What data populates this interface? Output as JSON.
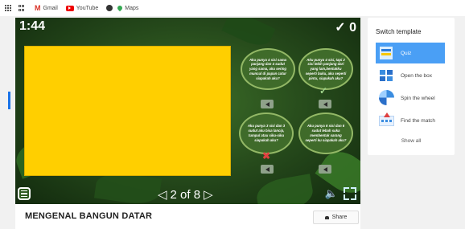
{
  "bookmarks": {
    "items": [
      {
        "label": "Gmail",
        "icon": "gmail-icon"
      },
      {
        "label": "YouTube",
        "icon": "youtube-icon"
      },
      {
        "label": "",
        "icon": "globe-icon"
      },
      {
        "label": "Maps",
        "icon": "maps-icon"
      }
    ]
  },
  "game": {
    "timer": "1:44",
    "score": "✓ 0",
    "pager": {
      "current": "2",
      "sep": "of",
      "total": "8",
      "text": "2 of 8"
    },
    "questions": [
      {
        "text": "Aku punya 4 sisi sama panjang dan 4 sudut yang sama, aku sering muncul di papan catur siapakah aku?"
      },
      {
        "text": "Aku punya 4 sisi, tapi 2 sisi lebih panjang dari yang lain,bentukku seperti buku, aku seperti pintu, siapakah aku?"
      },
      {
        "text": "Aku punya 3 sisi dan 3 sudut aku bisa lancip, tumpul atau siku-siku siapakah aku?"
      },
      {
        "text": "Aku punya 6 sisi dan 6 sudut lebah suka membentuk sarang seperti ku siapakah aku?"
      }
    ],
    "marks": {
      "correct": "✓",
      "wrong": "✖"
    },
    "colors": {
      "card": "#ffcf00",
      "bubble_border": "#93b866"
    }
  },
  "activity": {
    "title": "MENGENAL BANGUN DATAR",
    "share_label": "Share"
  },
  "switch_template": {
    "title": "Switch template",
    "items": [
      {
        "label": "Quiz",
        "selected": true,
        "icon": "quiz-icon"
      },
      {
        "label": "Open the box",
        "selected": false,
        "icon": "open-box-icon"
      },
      {
        "label": "Spin the wheel",
        "selected": false,
        "icon": "spin-wheel-icon"
      },
      {
        "label": "Find the match",
        "selected": false,
        "icon": "find-match-icon"
      }
    ],
    "show_all": "Show all",
    "accent": "#4a9ff5"
  }
}
